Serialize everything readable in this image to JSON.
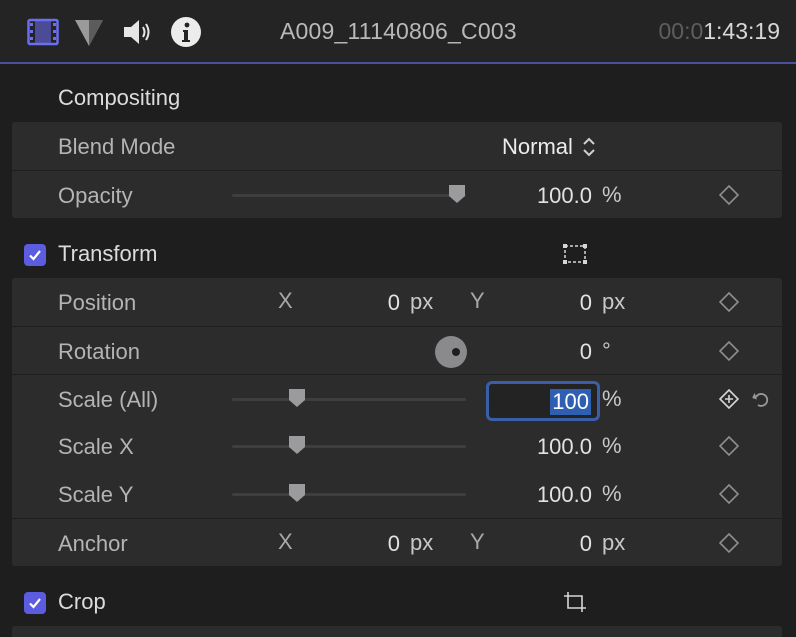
{
  "header": {
    "icons": [
      "film-strip-icon",
      "color-icon",
      "speaker-icon",
      "info-icon"
    ],
    "clip_name": "A009_11140806_C003",
    "timecode_dim": "00:0",
    "timecode_bright": "1:43:19"
  },
  "compositing": {
    "title": "Compositing",
    "blend_mode": {
      "label": "Blend Mode",
      "value": "Normal"
    },
    "opacity": {
      "label": "Opacity",
      "value": "100.0",
      "unit": "%",
      "slider_fraction": 1.0
    }
  },
  "transform": {
    "title": "Transform",
    "enabled": true,
    "position": {
      "label": "Position",
      "x_label": "X",
      "x_value": "0",
      "x_unit": "px",
      "y_label": "Y",
      "y_value": "0",
      "y_unit": "px"
    },
    "rotation": {
      "label": "Rotation",
      "value": "0",
      "unit": "°"
    },
    "scale_all": {
      "label": "Scale (All)",
      "value": "100",
      "unit": "%",
      "slider_fraction": 0.26
    },
    "scale_x": {
      "label": "Scale X",
      "value": "100.0",
      "unit": "%",
      "slider_fraction": 0.26
    },
    "scale_y": {
      "label": "Scale Y",
      "value": "100.0",
      "unit": "%",
      "slider_fraction": 0.26
    },
    "anchor": {
      "label": "Anchor",
      "x_label": "X",
      "x_value": "0",
      "x_unit": "px",
      "y_label": "Y",
      "y_value": "0",
      "y_unit": "px"
    }
  },
  "crop": {
    "title": "Crop",
    "enabled": true
  },
  "colors": {
    "accent": "#5b5ce0",
    "header_rule": "#4b4f9e",
    "edit_border": "#3a5ea8",
    "selection": "#2f5fb0"
  }
}
